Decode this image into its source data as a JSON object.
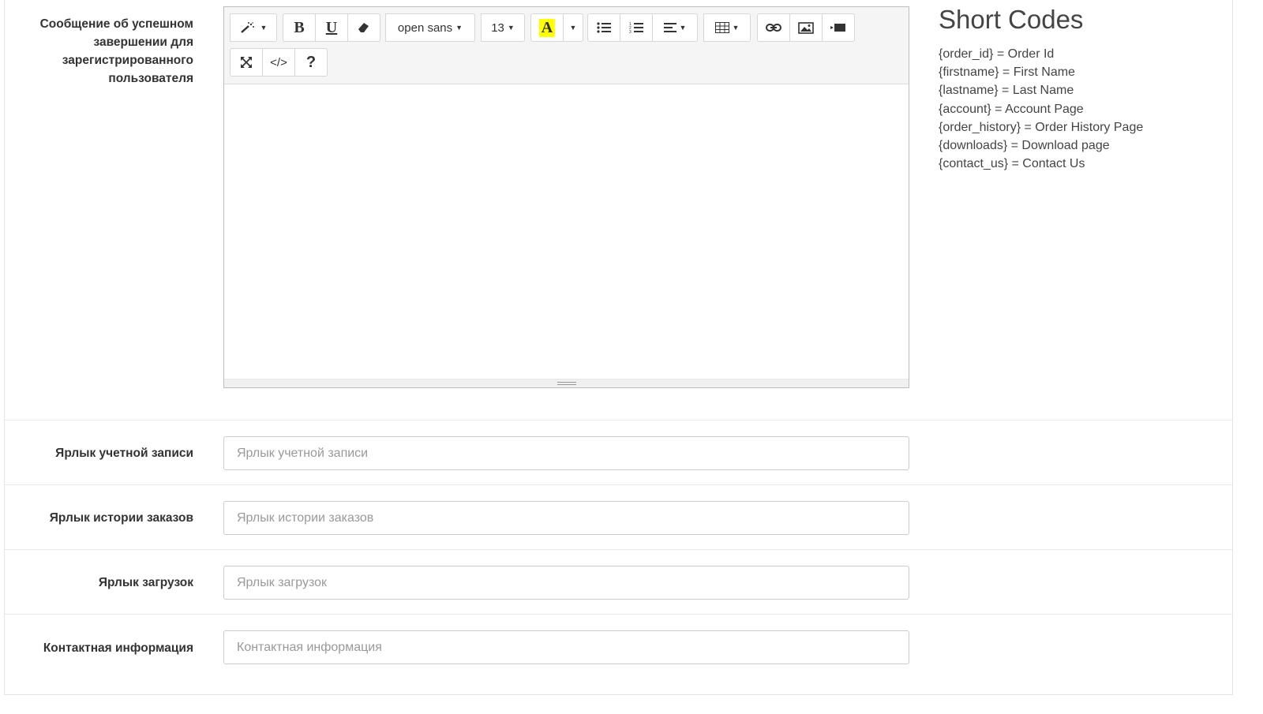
{
  "form": {
    "success_message_label": "Сообщение об успешном завершении для зарегистрированного пользователя",
    "fields": [
      {
        "label": "Ярлык учетной записи",
        "placeholder": "Ярлык учетной записи",
        "value": ""
      },
      {
        "label": "Ярлык истории заказов",
        "placeholder": "Ярлык истории заказов",
        "value": ""
      },
      {
        "label": "Ярлык загрузок",
        "placeholder": "Ярлык загрузок",
        "value": ""
      },
      {
        "label": "Контактная информация",
        "placeholder": "Контактная информация",
        "value": ""
      }
    ]
  },
  "editor": {
    "font_name": "open sans",
    "font_size": "13",
    "bold": "B",
    "underline": "U",
    "highlight_letter": "A",
    "code_view": "</>",
    "help": "?",
    "highlight_color": "#ffff00",
    "icons": [
      "magic-icon",
      "bold-icon",
      "underline-icon",
      "eraser-icon",
      "highlight-icon",
      "unordered-list-icon",
      "ordered-list-icon",
      "align-icon",
      "table-icon",
      "link-icon",
      "picture-icon",
      "video-icon",
      "fullscreen-icon",
      "code-icon",
      "help-icon"
    ]
  },
  "short_codes": {
    "title": "Short Codes",
    "items": [
      "{order_id} = Order Id",
      "{firstname} = First Name",
      "{lastname} = Last Name",
      "{account} = Account Page",
      "{order_history} = Order History Page",
      "{downloads} = Download page",
      "{contact_us} = Contact Us"
    ]
  }
}
